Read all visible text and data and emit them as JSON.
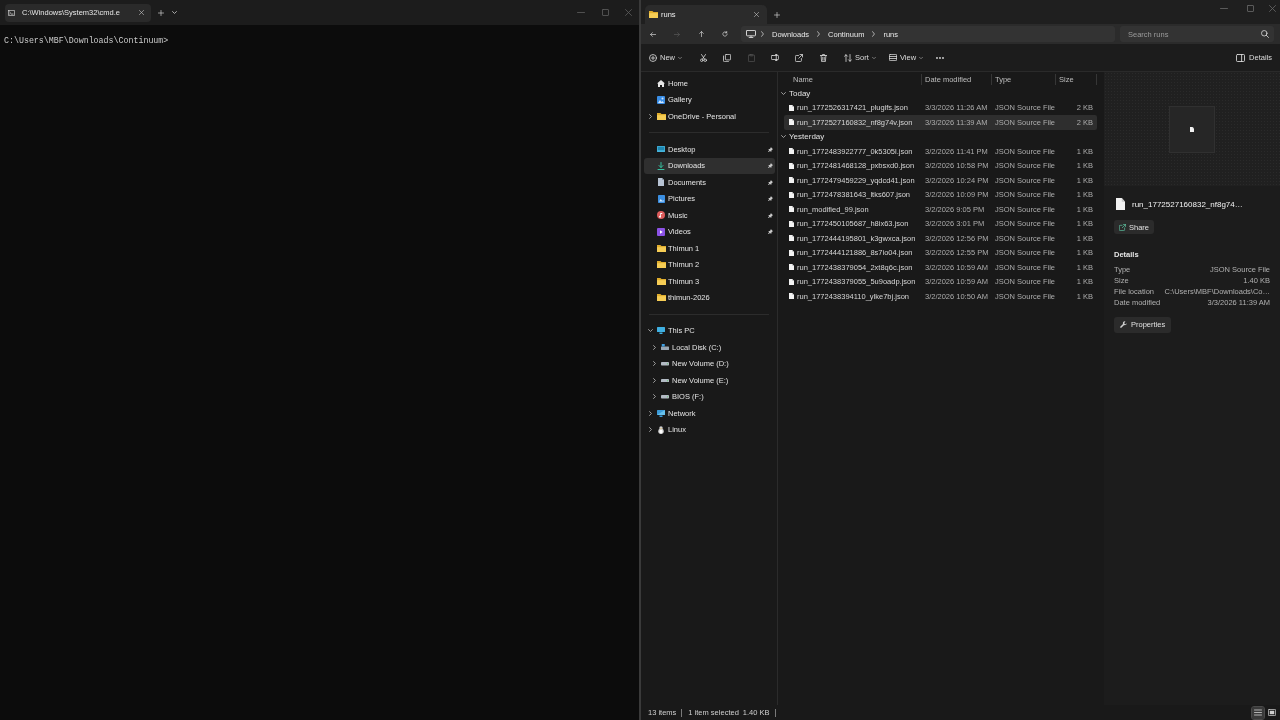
{
  "terminal": {
    "tabs": [
      {
        "title": "C:\\Windows\\System32\\cmd.e",
        "selected": true
      }
    ],
    "lines": [
      "C:\\Users\\MBF\\Downloads\\Continuum>"
    ]
  },
  "explorer": {
    "tabs": [
      {
        "title": "runs",
        "selected": true
      }
    ],
    "navigation": [
      {
        "kind": "back",
        "disabled": false
      },
      {
        "kind": "forward",
        "disabled": true
      },
      {
        "kind": "up",
        "disabled": false
      },
      {
        "kind": "refresh",
        "disabled": false
      }
    ],
    "breadcrumb": [
      "Downloads",
      "Continuum",
      "runs"
    ],
    "search": {
      "placeholder": "Search runs"
    },
    "toolbar": {
      "new": "New",
      "actions": [
        {
          "kind": "cut",
          "disabled": false
        },
        {
          "kind": "copy",
          "disabled": false
        },
        {
          "kind": "paste",
          "disabled": true
        },
        {
          "kind": "rename",
          "disabled": false
        },
        {
          "kind": "share",
          "disabled": false
        },
        {
          "kind": "delete",
          "disabled": false
        }
      ],
      "sort": "Sort",
      "view": "View",
      "details": "Details"
    },
    "sidebar": {
      "sections": [
        {
          "items": [
            {
              "label": "Home",
              "kind": "home",
              "selected": false
            },
            {
              "label": "Gallery",
              "kind": "gallery",
              "selected": false
            },
            {
              "label": "OneDrive - Personal",
              "kind": "folder",
              "selected": false,
              "expanded": false
            }
          ]
        },
        {
          "items": [
            {
              "label": "Desktop",
              "kind": "desktop",
              "selected": false,
              "pinned": true
            },
            {
              "label": "Downloads",
              "kind": "downloads",
              "selected": true,
              "pinned": true
            },
            {
              "label": "Documents",
              "kind": "documents",
              "selected": false,
              "pinned": true
            },
            {
              "label": "Pictures",
              "kind": "pictures",
              "selected": false,
              "pinned": true
            },
            {
              "label": "Music",
              "kind": "music",
              "selected": false,
              "pinned": true
            },
            {
              "label": "Videos",
              "kind": "videos",
              "selected": false,
              "pinned": true
            },
            {
              "label": "Thimun 1",
              "kind": "folder",
              "selected": false,
              "pinned": false
            },
            {
              "label": "Thimun 2",
              "kind": "folder",
              "selected": false,
              "pinned": false
            },
            {
              "label": "Thimun 3",
              "kind": "folder",
              "selected": false,
              "pinned": false
            },
            {
              "label": "thimun-2026",
              "kind": "folder",
              "selected": false,
              "pinned": false
            }
          ]
        },
        {
          "items": [
            {
              "label": "This PC",
              "kind": "pc",
              "selected": false,
              "expanded": true,
              "children": [
                {
                  "label": "Local Disk (C:)",
                  "kind": "system_drive",
                  "selected": false,
                  "expanded": false
                },
                {
                  "label": "New Volume (D:)",
                  "kind": "drive",
                  "selected": false,
                  "expanded": false
                },
                {
                  "label": "New Volume (E:)",
                  "kind": "drive",
                  "selected": false,
                  "expanded": false
                },
                {
                  "label": "BIOS (F:)",
                  "kind": "drive",
                  "selected": false,
                  "expanded": false
                }
              ]
            },
            {
              "label": "Network",
              "kind": "network",
              "selected": false,
              "expanded": false
            },
            {
              "label": "Linux",
              "kind": "linux",
              "selected": false,
              "expanded": false
            }
          ]
        }
      ]
    },
    "file_list": {
      "columns": [
        "Name",
        "Date modified",
        "Type",
        "Size"
      ],
      "groups": [
        {
          "label": "Today",
          "expanded": true,
          "rows": [
            {
              "name": "run_1772526317421_plugifs.json",
              "date_modified": "3/3/2026 11:26 AM",
              "type": "JSON Source File",
              "size": "2 KB",
              "selected": false
            },
            {
              "name": "run_1772527160832_nf8g74v.json",
              "date_modified": "3/3/2026 11:39 AM",
              "type": "JSON Source File",
              "size": "2 KB",
              "selected": true
            }
          ]
        },
        {
          "label": "Yesterday",
          "expanded": true,
          "rows": [
            {
              "name": "run_1772483922777_0k5305l.json",
              "date_modified": "3/2/2026 11:41 PM",
              "type": "JSON Source File",
              "size": "1 KB",
              "selected": false
            },
            {
              "name": "run_1772481468128_pxbsxd0.json",
              "date_modified": "3/2/2026 10:58 PM",
              "type": "JSON Source File",
              "size": "1 KB",
              "selected": false
            },
            {
              "name": "run_1772479459229_yqdcd41.json",
              "date_modified": "3/2/2026 10:24 PM",
              "type": "JSON Source File",
              "size": "1 KB",
              "selected": false
            },
            {
              "name": "run_1772478381643_ltks607.json",
              "date_modified": "3/2/2026 10:09 PM",
              "type": "JSON Source File",
              "size": "1 KB",
              "selected": false
            },
            {
              "name": "run_modified_99.json",
              "date_modified": "3/2/2026 9:05 PM",
              "type": "JSON Source File",
              "size": "1 KB",
              "selected": false
            },
            {
              "name": "run_1772450105687_h8ix63.json",
              "date_modified": "3/2/2026 3:01 PM",
              "type": "JSON Source File",
              "size": "1 KB",
              "selected": false
            },
            {
              "name": "run_1772444195801_k3gwxca.json",
              "date_modified": "3/2/2026 12:56 PM",
              "type": "JSON Source File",
              "size": "1 KB",
              "selected": false
            },
            {
              "name": "run_1772444121886_8s7io04.json",
              "date_modified": "3/2/2026 12:55 PM",
              "type": "JSON Source File",
              "size": "1 KB",
              "selected": false
            },
            {
              "name": "run_1772438379054_2xt8q6c.json",
              "date_modified": "3/2/2026 10:59 AM",
              "type": "JSON Source File",
              "size": "1 KB",
              "selected": false
            },
            {
              "name": "run_1772438379055_5u9oadp.json",
              "date_modified": "3/2/2026 10:59 AM",
              "type": "JSON Source File",
              "size": "1 KB",
              "selected": false
            },
            {
              "name": "run_1772438394110_ylke7bj.json",
              "date_modified": "3/2/2026 10:50 AM",
              "type": "JSON Source File",
              "size": "1 KB",
              "selected": false
            }
          ]
        }
      ]
    },
    "details_pane": {
      "file_name": "run_1772527160832_nf8g74…",
      "share": "Share",
      "heading": "Details",
      "properties": [
        {
          "label": "Type",
          "value": "JSON Source File"
        },
        {
          "label": "Size",
          "value": "1.40 KB"
        },
        {
          "label": "File location",
          "value": "C:\\Users\\MBF\\Downloads\\Co…"
        },
        {
          "label": "Date modified",
          "value": "3/3/2026 11:39 AM"
        }
      ],
      "properties_button": "Properties"
    },
    "status_bar": {
      "item_count": "13 items",
      "selection": "1 item selected",
      "selection_size": "1.40 KB",
      "views": [
        {
          "kind": "details",
          "selected": true
        },
        {
          "kind": "tiles",
          "selected": false
        }
      ]
    }
  }
}
